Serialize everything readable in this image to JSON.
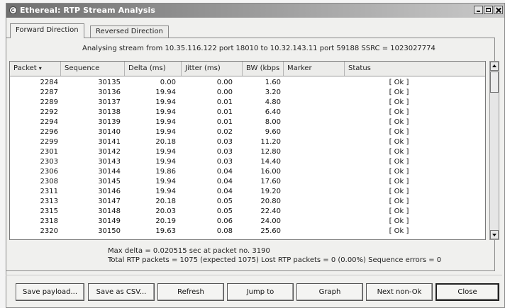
{
  "window": {
    "title": "Ethereal: RTP Stream Analysis",
    "icon": "ethereal-app-icon"
  },
  "tabs": [
    {
      "label": "Forward Direction",
      "active": true
    },
    {
      "label": "Reversed Direction",
      "active": false
    }
  ],
  "analysing_text": "Analysing stream from  10.35.116.122 port 18010  to  10.32.143.11 port 59188  SSRC = 1023027774",
  "table": {
    "columns": [
      "Packet",
      "Sequence",
      "Delta (ms)",
      "Jitter (ms)",
      "BW (kbps",
      "Marker",
      "Status"
    ],
    "sort_indicator": "▾",
    "rows": [
      {
        "packet": "2284",
        "sequence": "30135",
        "delta": "0.00",
        "jitter": "0.00",
        "bw": "1.60",
        "marker": "",
        "status": "[ Ok ]"
      },
      {
        "packet": "2287",
        "sequence": "30136",
        "delta": "19.94",
        "jitter": "0.00",
        "bw": "3.20",
        "marker": "",
        "status": "[ Ok ]"
      },
      {
        "packet": "2289",
        "sequence": "30137",
        "delta": "19.94",
        "jitter": "0.01",
        "bw": "4.80",
        "marker": "",
        "status": "[ Ok ]"
      },
      {
        "packet": "2292",
        "sequence": "30138",
        "delta": "19.94",
        "jitter": "0.01",
        "bw": "6.40",
        "marker": "",
        "status": "[ Ok ]"
      },
      {
        "packet": "2294",
        "sequence": "30139",
        "delta": "19.94",
        "jitter": "0.01",
        "bw": "8.00",
        "marker": "",
        "status": "[ Ok ]"
      },
      {
        "packet": "2296",
        "sequence": "30140",
        "delta": "19.94",
        "jitter": "0.02",
        "bw": "9.60",
        "marker": "",
        "status": "[ Ok ]"
      },
      {
        "packet": "2299",
        "sequence": "30141",
        "delta": "20.18",
        "jitter": "0.03",
        "bw": "11.20",
        "marker": "",
        "status": "[ Ok ]"
      },
      {
        "packet": "2301",
        "sequence": "30142",
        "delta": "19.94",
        "jitter": "0.03",
        "bw": "12.80",
        "marker": "",
        "status": "[ Ok ]"
      },
      {
        "packet": "2303",
        "sequence": "30143",
        "delta": "19.94",
        "jitter": "0.03",
        "bw": "14.40",
        "marker": "",
        "status": "[ Ok ]"
      },
      {
        "packet": "2306",
        "sequence": "30144",
        "delta": "19.86",
        "jitter": "0.04",
        "bw": "16.00",
        "marker": "",
        "status": "[ Ok ]"
      },
      {
        "packet": "2308",
        "sequence": "30145",
        "delta": "19.94",
        "jitter": "0.04",
        "bw": "17.60",
        "marker": "",
        "status": "[ Ok ]"
      },
      {
        "packet": "2311",
        "sequence": "30146",
        "delta": "19.94",
        "jitter": "0.04",
        "bw": "19.20",
        "marker": "",
        "status": "[ Ok ]"
      },
      {
        "packet": "2313",
        "sequence": "30147",
        "delta": "20.18",
        "jitter": "0.05",
        "bw": "20.80",
        "marker": "",
        "status": "[ Ok ]"
      },
      {
        "packet": "2315",
        "sequence": "30148",
        "delta": "20.03",
        "jitter": "0.05",
        "bw": "22.40",
        "marker": "",
        "status": "[ Ok ]"
      },
      {
        "packet": "2318",
        "sequence": "30149",
        "delta": "20.19",
        "jitter": "0.06",
        "bw": "24.00",
        "marker": "",
        "status": "[ Ok ]"
      },
      {
        "packet": "2320",
        "sequence": "30150",
        "delta": "19.63",
        "jitter": "0.08",
        "bw": "25.60",
        "marker": "",
        "status": "[ Ok ]"
      }
    ]
  },
  "summary": {
    "max_delta": "Max delta = 0.020515 sec at packet no. 3190",
    "totals": "Total RTP packets = 1075   (expected 1075)   Lost RTP packets = 0 (0.00%)   Sequence errors = 0"
  },
  "buttons": [
    {
      "key": "save_payload",
      "label": "Save payload..."
    },
    {
      "key": "save_csv",
      "label": "Save as CSV..."
    },
    {
      "key": "refresh",
      "label": "Refresh"
    },
    {
      "key": "jump_to",
      "label": "Jump to"
    },
    {
      "key": "graph",
      "label": "Graph"
    },
    {
      "key": "next_non_ok",
      "label": "Next non-Ok"
    },
    {
      "key": "close",
      "label": "Close",
      "default": true
    }
  ]
}
